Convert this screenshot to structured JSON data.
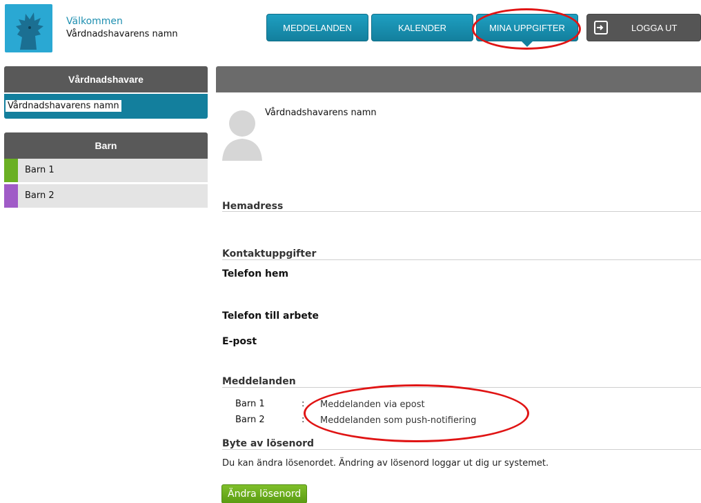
{
  "header": {
    "welcome": "Välkommen",
    "user_name": "Vårdnadshavarens namn"
  },
  "nav": {
    "messages": "MEDDELANDEN",
    "calendar": "KALENDER",
    "my_info": "MINA UPPGIFTER",
    "logout": "LOGGA UT"
  },
  "sidebar": {
    "guardian_title": "Vårdnadshavare",
    "guardian_name": "Vårdnadshavarens namn",
    "children_title": "Barn",
    "children": [
      {
        "label": "Barn 1",
        "color": "#6ab023"
      },
      {
        "label": "Barn 2",
        "color": "#a05bc7"
      }
    ]
  },
  "profile": {
    "name": "Vårdnadshavarens namn"
  },
  "sections": {
    "home_address": "Hemadress",
    "contact": "Kontaktuppgifter",
    "phone_home": "Telefon hem",
    "phone_work": "Telefon till arbete",
    "email": "E-post",
    "messages": "Meddelanden",
    "password": "Byte av lösenord"
  },
  "messages": [
    {
      "child": "Barn 1",
      "colon": ":",
      "value": "Meddelanden via epost"
    },
    {
      "child": "Barn 2",
      "colon": ":",
      "value": "Meddelanden som push-notifiering"
    }
  ],
  "password": {
    "description": "Du kan ändra lösenordet. Ändring av lösenord loggar ut dig ur systemet.",
    "button": "Ändra lösenord"
  },
  "colors": {
    "accent": "#137f9d",
    "annotation": "#e01414",
    "button_green": "#5a9c12"
  }
}
